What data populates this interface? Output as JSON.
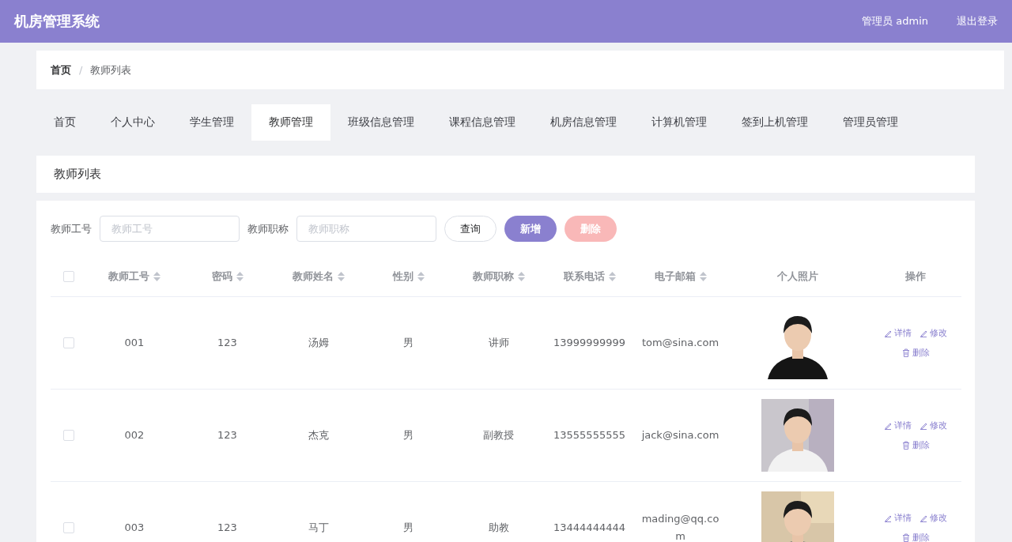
{
  "header": {
    "title": "机房管理系统",
    "user": "管理员 admin",
    "logout": "退出登录"
  },
  "breadcrumb_separator": "/",
  "breadcrumb": [
    {
      "label": "首页",
      "current": false
    },
    {
      "label": "教师列表",
      "current": true
    }
  ],
  "tabs": [
    {
      "label": "首页",
      "selected": false
    },
    {
      "label": "个人中心",
      "selected": false
    },
    {
      "label": "学生管理",
      "selected": false
    },
    {
      "label": "教师管理",
      "selected": true
    },
    {
      "label": "班级信息管理",
      "selected": false
    },
    {
      "label": "课程信息管理",
      "selected": false
    },
    {
      "label": "机房信息管理",
      "selected": false
    },
    {
      "label": "计算机管理",
      "selected": false
    },
    {
      "label": "签到上机管理",
      "selected": false
    },
    {
      "label": "管理员管理",
      "selected": false
    }
  ],
  "section_title": "教师列表",
  "search": [
    {
      "label": "教师工号",
      "placeholder": "教师工号"
    },
    {
      "label": "教师职称",
      "placeholder": "教师职称"
    }
  ],
  "buttons": [
    {
      "label": "查询",
      "kind": "plain"
    },
    {
      "label": "新增",
      "kind": "primary"
    },
    {
      "label": "删除",
      "kind": "danger",
      "disabled": true
    }
  ],
  "table": {
    "select_all_checked": false,
    "columns": [
      {
        "label": "教师工号",
        "sortable": true
      },
      {
        "label": "密码",
        "sortable": true
      },
      {
        "label": "教师姓名",
        "sortable": true
      },
      {
        "label": "性别",
        "sortable": true
      },
      {
        "label": "教师职称",
        "sortable": true
      },
      {
        "label": "联系电话",
        "sortable": true
      },
      {
        "label": "电子邮箱",
        "sortable": true
      },
      {
        "label": "个人照片",
        "sortable": false
      },
      {
        "label": "操作",
        "sortable": false
      }
    ],
    "rows": [
      {
        "checked": false,
        "cells": [
          "001",
          "123",
          "汤姆",
          "男",
          "讲师",
          "13999999999",
          "tom@sina.com"
        ],
        "actions": [
          "详情",
          "修改",
          "删除"
        ]
      },
      {
        "checked": false,
        "cells": [
          "002",
          "123",
          "杰克",
          "男",
          "副教授",
          "13555555555",
          "jack@sina.com"
        ],
        "actions": [
          "详情",
          "修改",
          "删除"
        ]
      },
      {
        "checked": false,
        "cells": [
          "003",
          "123",
          "马丁",
          "男",
          "助教",
          "13444444444",
          "mading@qq.com"
        ],
        "actions": [
          "详情",
          "修改",
          "删除"
        ]
      }
    ]
  }
}
